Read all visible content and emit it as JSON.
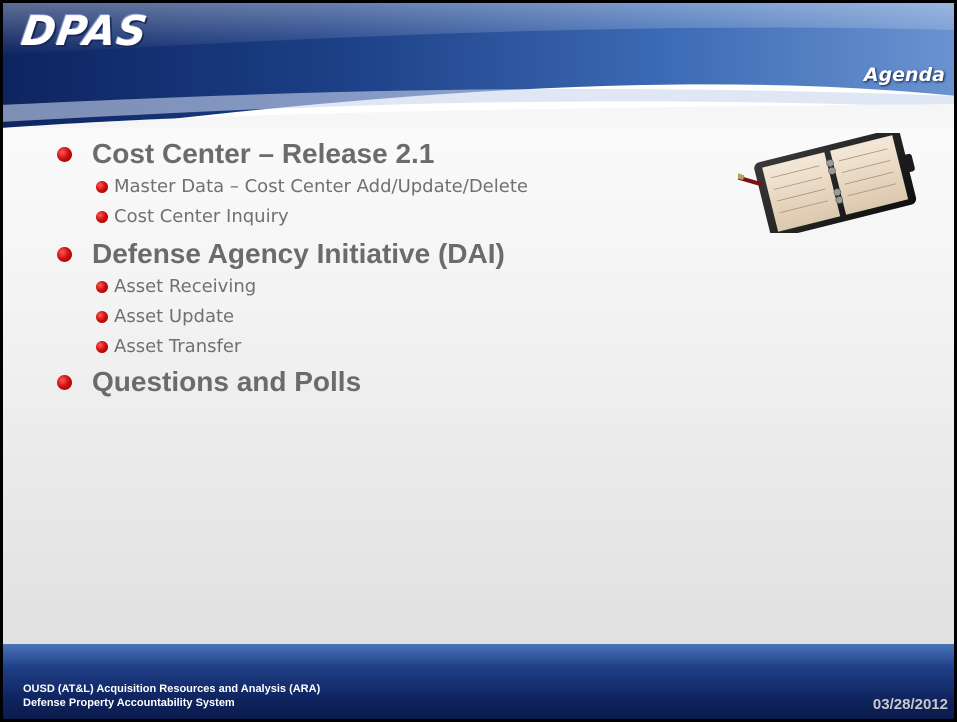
{
  "header": {
    "logo_text": "DPAS",
    "section_title": "Agenda"
  },
  "agenda": {
    "items": [
      {
        "label": "Cost Center – Release 2.1",
        "subitems": [
          "Master Data – Cost Center Add/Update/Delete",
          "Cost Center Inquiry"
        ]
      },
      {
        "label": "Defense Agency Initiative (DAI)",
        "subitems": [
          "Asset Receiving",
          "Asset Update",
          "Asset Transfer"
        ]
      },
      {
        "label": "Questions and Polls",
        "subitems": []
      }
    ]
  },
  "footer": {
    "org_line": "OUSD (AT&L) Acquisition Resources and Analysis (ARA)",
    "system_line": "Defense Property Accountability System",
    "date": "03/28/2012"
  },
  "colors": {
    "bullet": "#d01010",
    "header_blue": "#1f3f86",
    "text_gray": "#6b6b6b"
  },
  "icons": {
    "bullet": "red-ball-bullet",
    "planner": "agenda-planner-icon"
  }
}
